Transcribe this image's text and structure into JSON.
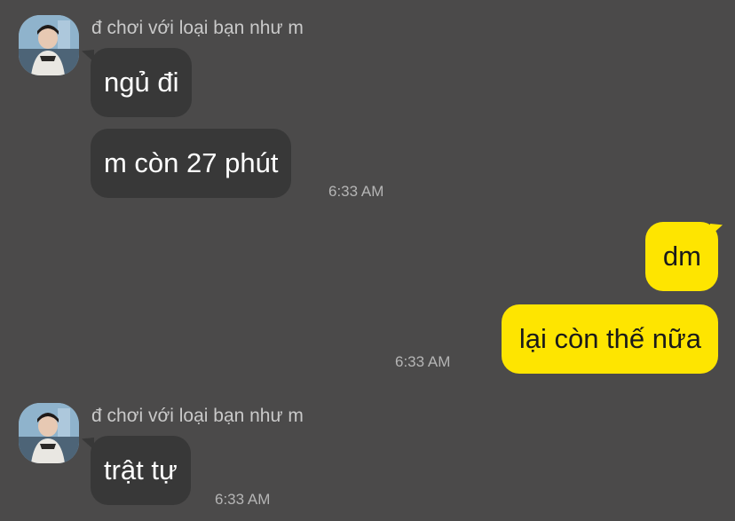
{
  "conversation": {
    "messages": [
      {
        "sender_name": "đ chơi với loại bạn như m",
        "text": "ngủ đi"
      },
      {
        "text": "m còn 27 phút",
        "time": "6:33 AM"
      },
      {
        "text": "dm"
      },
      {
        "text": "lại còn thế nữa",
        "time": "6:33 AM"
      },
      {
        "sender_name": "đ chơi với loại bạn như m",
        "text": "trật tự",
        "time": "6:33 AM"
      }
    ]
  },
  "colors": {
    "background": "#4b4a4a",
    "incoming_bubble": "#383838",
    "outgoing_bubble": "#fee500",
    "sender_text": "#c9c9c9",
    "timestamp_text": "#b5b5b5"
  },
  "icons": {
    "avatar": "profile-photo"
  }
}
